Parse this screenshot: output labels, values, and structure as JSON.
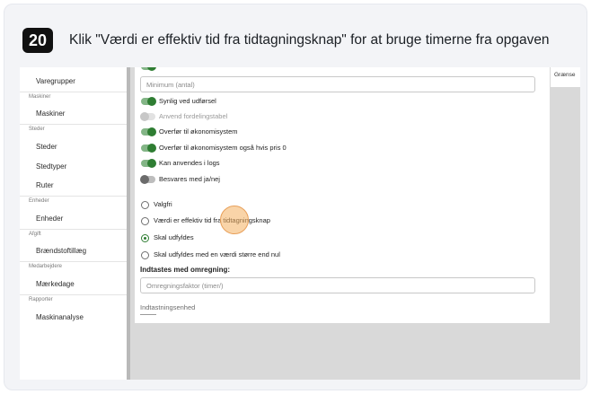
{
  "step": {
    "number": "20",
    "title": "Klik \"Værdi er effektiv tid fra tidtagningsknap\" for at bruge timerne fra opgaven"
  },
  "sidebar": {
    "items": [
      {
        "type": "item",
        "label": "Varegrupper"
      },
      {
        "type": "section",
        "label": "Maskiner"
      },
      {
        "type": "item",
        "label": "Maskiner"
      },
      {
        "type": "section",
        "label": "Steder"
      },
      {
        "type": "item",
        "label": "Steder"
      },
      {
        "type": "item",
        "label": "Stedtyper"
      },
      {
        "type": "item",
        "label": "Ruter"
      },
      {
        "type": "section",
        "label": "Enheder"
      },
      {
        "type": "item",
        "label": "Enheder"
      },
      {
        "type": "section",
        "label": "Afgift"
      },
      {
        "type": "item",
        "label": "Brændstoftillæg"
      },
      {
        "type": "section",
        "label": "Medarbejdere"
      },
      {
        "type": "item",
        "label": "Mærkedage"
      },
      {
        "type": "section",
        "label": "Rapporter"
      },
      {
        "type": "item",
        "label": "Maskinanalyse"
      }
    ]
  },
  "right_panel": {
    "label": "Grænse"
  },
  "form": {
    "minimum_placeholder": "Minimum (antal)",
    "toggles": [
      {
        "label": "Synlig ved udførsel",
        "state": "on"
      },
      {
        "label": "Anvend fordelingstabel",
        "state": "disabled"
      },
      {
        "label": "Overfør til økonomisystem",
        "state": "on"
      },
      {
        "label": "Overfør til økonomisystem også hvis pris 0",
        "state": "on"
      },
      {
        "label": "Kan anvendes i logs",
        "state": "on"
      },
      {
        "label": "Besvares med ja/nej",
        "state": "off"
      }
    ],
    "radios": [
      {
        "label": "Valgfri",
        "checked": false
      },
      {
        "label": "Værdi er effektiv tid fra tidtagningsknap",
        "checked": false
      },
      {
        "label": "Skal udfyldes",
        "checked": true
      },
      {
        "label": "Skal udfyldes med en værdi større end nul",
        "checked": false
      }
    ],
    "conversion_heading": "Indtastes med omregning:",
    "conversion_placeholder": "Omregningsfaktor (timer/)",
    "unit_label": "Indtastningsenhed"
  },
  "colors": {
    "toggle_on": "#2e7d32",
    "click_marker": "#f4b060"
  }
}
